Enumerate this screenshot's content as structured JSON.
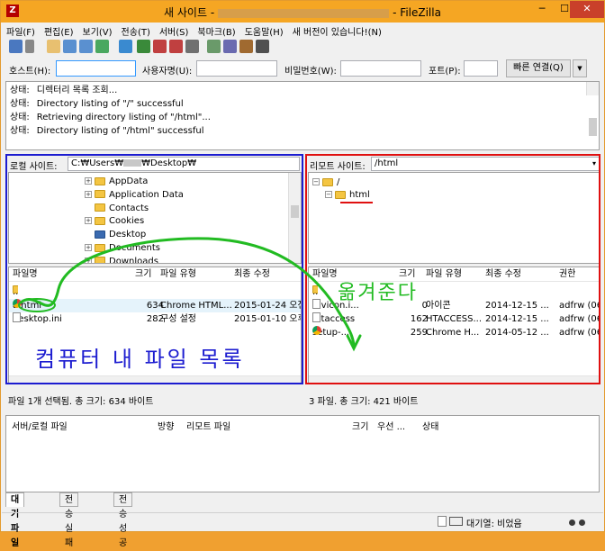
{
  "window": {
    "title_left": "새 사이트 -",
    "title_right": "- FileZilla",
    "app_icon": "Z"
  },
  "menu": [
    "파일(F)",
    "편집(E)",
    "보기(V)",
    "전송(T)",
    "서버(S)",
    "북마크(B)",
    "도움말(H)",
    "새 버전이 있습니다!(N)"
  ],
  "quickconnect": {
    "host_label": "호스트(H):",
    "user_label": "사용자명(U):",
    "pass_label": "비밀번호(W):",
    "port_label": "포트(P):",
    "connect_button": "빠른 연결(Q)",
    "dropdown_glyph": "▼"
  },
  "log": [
    {
      "prefix": "상태:",
      "text": "디렉터리 목록 조회..."
    },
    {
      "prefix": "상태:",
      "text": "Directory listing of \"/\" successful"
    },
    {
      "prefix": "상태:",
      "text": "Retrieving directory listing of \"/html\"..."
    },
    {
      "prefix": "상태:",
      "text": "Directory listing of \"/html\" successful"
    }
  ],
  "local": {
    "site_label": "로컬 사이트:",
    "path": "C:₩Users₩",
    "path_tail": "₩Desktop₩",
    "tree": [
      "AppData",
      "Application Data",
      "Contacts",
      "Cookies",
      "Desktop",
      "Documents",
      "Downloads"
    ],
    "columns": [
      "파일명",
      "크기",
      "파일 유형",
      "최종 수정"
    ],
    "files": [
      {
        "name": "..",
        "size": "",
        "type": "",
        "modified": ""
      },
      {
        "name": "a.html",
        "size": "634",
        "type": "Chrome HTML...",
        "modified": "2015-01-24 오전"
      },
      {
        "name": "desktop.ini",
        "size": "282",
        "type": "구성 설정",
        "modified": "2015-01-10 오후"
      }
    ],
    "status": "파일 1개 선택됨. 총 크기: 634 바이트"
  },
  "remote": {
    "site_label": "리모트 사이트:",
    "path": "/html",
    "tree": [
      "/",
      "html"
    ],
    "columns": [
      "파일명",
      "크기",
      "파일 유형",
      "최종 수정",
      "권한"
    ],
    "files": [
      {
        "name": "..",
        "size": "",
        "type": "",
        "modified": "",
        "perm": ""
      },
      {
        "name": "favicon.i...",
        "size": "0",
        "type": "아이콘",
        "modified": "2014-12-15 ...",
        "perm": "adfrw (06..."
      },
      {
        "name": ".htaccess",
        "size": "162",
        "type": "HTACCESS...",
        "modified": "2014-12-15 ...",
        "perm": "adfrw (06..."
      },
      {
        "name": "setup-...",
        "size": "259",
        "type": "Chrome H...",
        "modified": "2014-05-12 ...",
        "perm": "adfrw (06..."
      }
    ],
    "status": "3 파일. 총 크기: 421 바이트"
  },
  "queue": {
    "columns": [
      "서버/로컬 파일",
      "방향",
      "리모트 파일",
      "크기",
      "우선 ...",
      "상태"
    ]
  },
  "tabs": [
    "대기 파일",
    "전송 실패",
    "전송 성공"
  ],
  "statusbar": {
    "queue": "대기열: 비었음"
  },
  "annotations": {
    "local_caption": "컴퓨터 내 파일 목록",
    "arrow_caption": "옮겨준다",
    "local_color": "#1c1cd0",
    "remote_color": "#e01010",
    "arrow_color": "#22bb22"
  }
}
